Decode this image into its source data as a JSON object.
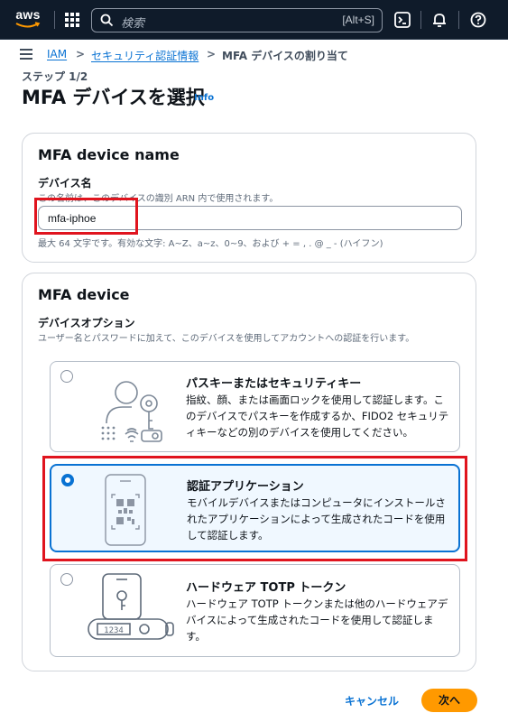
{
  "topbar": {
    "logo_text": "aws",
    "search_placeholder": "検索",
    "search_shortcut": "[Alt+S]",
    "icons": [
      "services-grid-icon",
      "search-icon",
      "cloudshell-icon",
      "bell-icon",
      "help-icon"
    ]
  },
  "breadcrumb": {
    "items": [
      "IAM",
      "セキュリティ認証情報",
      "MFA デバイスの割り当て"
    ],
    "separator": ">"
  },
  "page": {
    "step": "ステップ 1/2",
    "title": "MFA デバイスを選択",
    "info": "Info"
  },
  "device_name_panel": {
    "title": "MFA device name",
    "field_label": "デバイス名",
    "field_description": "この名前は、このデバイスの識別 ARN 内で使用されます。",
    "value": "mfa-iphoe",
    "constraint": "最大 64 文字です。有効な文字: A~Z、a~z、0~9、および + = , . @ _ - (ハイフン)"
  },
  "device_panel": {
    "title": "MFA device",
    "options_label": "デバイスオプション",
    "options_description": "ユーザー名とパスワードに加えて、このデバイスを使用してアカウントへの認証を行います。",
    "options": [
      {
        "title": "パスキーまたはセキュリティキー",
        "description": "指紋、顔、または画面ロックを使用して認証します。このデバイスでパスキーを作成するか、FIDO2 セキュリティキーなどの別のデバイスを使用してください。",
        "selected": false,
        "icon": "passkey-icon"
      },
      {
        "title": "認証アプリケーション",
        "description": "モバイルデバイスまたはコンピュータにインストールされたアプリケーションによって生成されたコードを使用して認証します。",
        "selected": true,
        "icon": "authenticator-app-icon"
      },
      {
        "title": "ハードウェア TOTP トークン",
        "description": "ハードウェア TOTP トークンまたは他のハードウェアデバイスによって生成されたコードを使用して認証します。",
        "selected": false,
        "icon": "hardware-token-icon",
        "token_display": "1234"
      }
    ]
  },
  "footer": {
    "cancel": "キャンセル",
    "next": "次へ"
  },
  "colors": {
    "accent": "#0972d3",
    "primary_button": "#ff9900",
    "highlight": "#e0141e",
    "topbar": "#0f1b2a"
  }
}
